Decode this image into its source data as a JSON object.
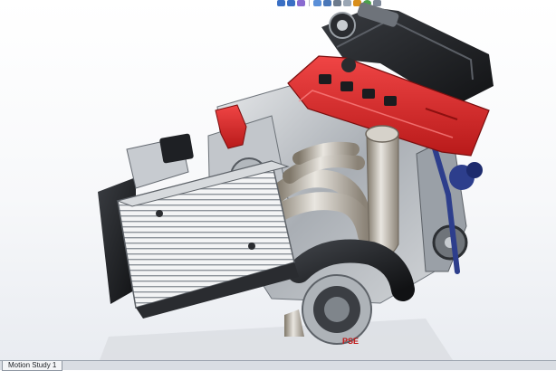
{
  "heads_up_toolbar": {
    "icons": [
      {
        "name": "zoom-to-fit-icon",
        "color": "#3a6fc4"
      },
      {
        "name": "zoom-to-area-icon",
        "color": "#3a6fc4"
      },
      {
        "name": "previous-view-icon",
        "color": "#8a6bd0"
      },
      {
        "name": "section-view-icon",
        "color": "#5a8fd8"
      },
      {
        "name": "view-orientation-icon",
        "color": "#4a77b8"
      },
      {
        "name": "display-style-icon",
        "color": "#6c7a8c"
      },
      {
        "name": "hide-show-items-icon",
        "color": "#9aa6b4"
      },
      {
        "name": "edit-appearance-icon",
        "color": "#d98f1c"
      },
      {
        "name": "apply-scene-icon",
        "color": "#4aa04a"
      },
      {
        "name": "view-settings-icon",
        "color": "#7d8797"
      }
    ]
  },
  "model": {
    "intercooler_logo": "PSE"
  },
  "bottom_tabs": {
    "tabs": [
      {
        "label": "Motion Study 1"
      }
    ]
  },
  "colors": {
    "valve_cover": "#d42a2a",
    "metal": "#b7bcc1",
    "dark_part": "#1c1e22",
    "accent_blue": "#2d3e8c"
  }
}
